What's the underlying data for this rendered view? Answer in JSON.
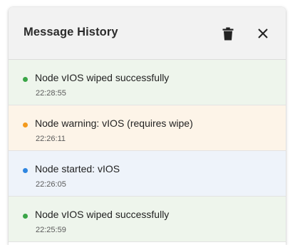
{
  "panel": {
    "title": "Message History",
    "trash_icon": "trash-icon",
    "close_icon": "close-icon"
  },
  "colors": {
    "success_bg": "#eef5ec",
    "success_dot": "#3aa547",
    "warning_bg": "#fdf4e8",
    "warning_dot": "#f39a1d",
    "info_bg": "#eef3fa",
    "info_dot": "#2f86e0"
  },
  "messages": [
    {
      "type": "success",
      "text": "Node vIOS wiped successfully",
      "time": "22:28:55"
    },
    {
      "type": "warning",
      "text": "Node warning: vIOS (requires wipe)",
      "time": "22:26:11"
    },
    {
      "type": "info",
      "text": "Node started: vIOS",
      "time": "22:26:05"
    },
    {
      "type": "success",
      "text": "Node vIOS wiped successfully",
      "time": "22:25:59"
    }
  ]
}
